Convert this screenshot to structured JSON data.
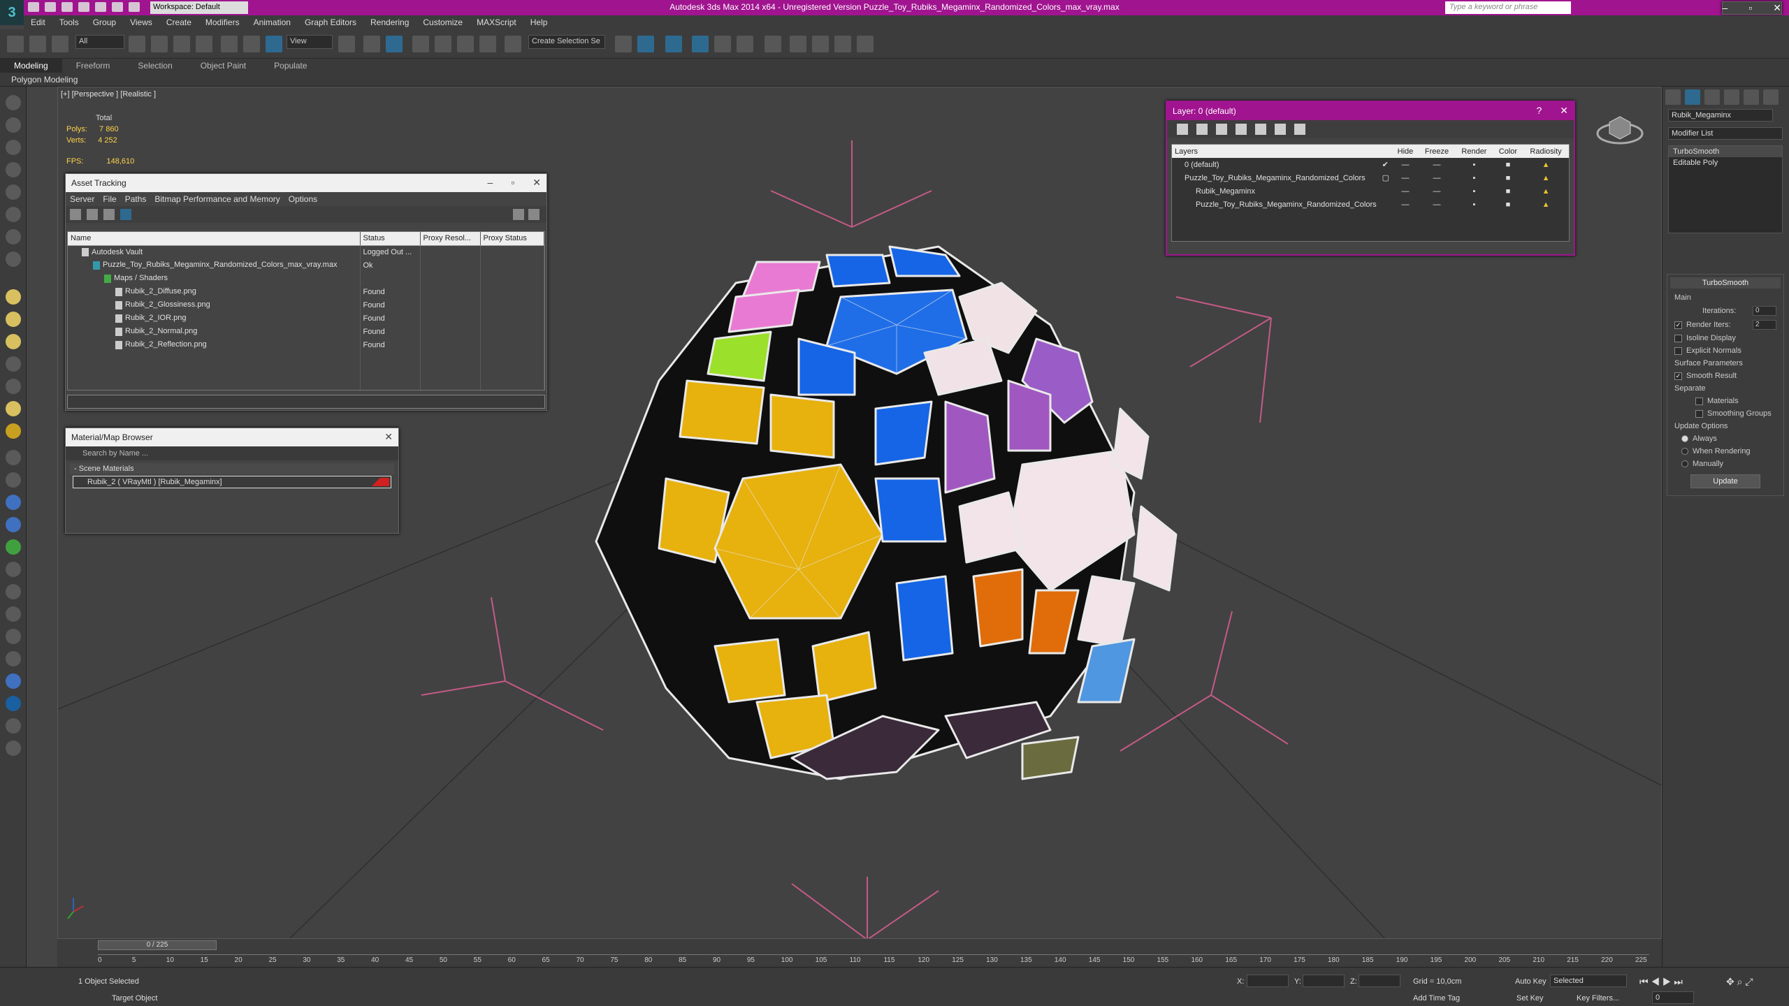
{
  "window": {
    "title": "Autodesk 3ds Max  2014 x64  -  Unregistered Version   Puzzle_Toy_Rubiks_Megaminx_Randomized_Colors_max_vray.max",
    "workspace": "Workspace: Default",
    "search_placeholder": "Type a keyword or phrase",
    "logo": "3"
  },
  "menu": [
    "Edit",
    "Tools",
    "Group",
    "Views",
    "Create",
    "Modifiers",
    "Animation",
    "Graph Editors",
    "Rendering",
    "Customize",
    "MAXScript",
    "Help"
  ],
  "toolbar": {
    "filter": "All",
    "refcoord": "View",
    "selection_set": "Create Selection Se"
  },
  "ribbon": {
    "tabs": [
      "Modeling",
      "Freeform",
      "Selection",
      "Object Paint",
      "Populate"
    ],
    "subtab": "Polygon Modeling"
  },
  "viewport": {
    "label": "[+] [Perspective ] [Realistic ]",
    "stats_header": "Total",
    "polys_label": "Polys:",
    "polys": "7 860",
    "verts_label": "Verts:",
    "verts": "4 252",
    "fps_label": "FPS:",
    "fps": "148,610"
  },
  "asset_tracking": {
    "title": "Asset Tracking",
    "menu": [
      "Server",
      "File",
      "Paths",
      "Bitmap Performance and Memory",
      "Options"
    ],
    "columns": [
      "Name",
      "Status",
      "Proxy Resol...",
      "Proxy Status"
    ],
    "rows": [
      {
        "name": "Autodesk Vault",
        "status": "Logged Out ..."
      },
      {
        "name": "Puzzle_Toy_Rubiks_Megaminx_Randomized_Colors_max_vray.max",
        "status": "Ok"
      },
      {
        "name": "Maps / Shaders",
        "status": ""
      },
      {
        "name": "Rubik_2_Diffuse.png",
        "status": "Found"
      },
      {
        "name": "Rubik_2_Glossiness.png",
        "status": "Found"
      },
      {
        "name": "Rubik_2_IOR.png",
        "status": "Found"
      },
      {
        "name": "Rubik_2_Normal.png",
        "status": "Found"
      },
      {
        "name": "Rubik_2_Reflection.png",
        "status": "Found"
      }
    ]
  },
  "material_browser": {
    "title": "Material/Map Browser",
    "search_placeholder": "Search by Name ...",
    "section": "- Scene Materials",
    "item": "Rubik_2  ( VRayMtl )  [Rubik_Megaminx]"
  },
  "layer_window": {
    "title": "Layer: 0 (default)",
    "columns": [
      "Layers",
      "Hide",
      "Freeze",
      "Render",
      "Color",
      "Radiosity"
    ],
    "rows": [
      {
        "name": "0 (default)"
      },
      {
        "name": "Puzzle_Toy_Rubiks_Megaminx_Randomized_Colors"
      },
      {
        "name": "Rubik_Megaminx"
      },
      {
        "name": "Puzzle_Toy_Rubiks_Megaminx_Randomized_Colors"
      }
    ]
  },
  "command_panel": {
    "object_name": "Rubik_Megaminx",
    "modifier_list": "Modifier List",
    "stack": [
      "TurboSmooth",
      "Editable Poly"
    ],
    "turbosmooth": {
      "title": "TurboSmooth",
      "main": "Main",
      "iterations_label": "Iterations:",
      "iterations": "0",
      "render_iters_label": "Render Iters:",
      "render_iters": "2",
      "isoline": "Isoline Display",
      "explicit": "Explicit Normals",
      "surface_params": "Surface Parameters",
      "smooth_result": "Smooth Result",
      "separate": "Separate",
      "materials": "Materials",
      "smoothing_groups": "Smoothing Groups",
      "update_options": "Update Options",
      "always": "Always",
      "when_rendering": "When Rendering",
      "manually": "Manually",
      "update_button": "Update"
    }
  },
  "timeline": {
    "slider": "0 / 225",
    "ticks": [
      "0",
      "5",
      "10",
      "15",
      "20",
      "25",
      "30",
      "35",
      "40",
      "45",
      "50",
      "55",
      "60",
      "65",
      "70",
      "75",
      "80",
      "85",
      "90",
      "95",
      "100",
      "105",
      "110",
      "115",
      "120",
      "125",
      "130",
      "135",
      "140",
      "145",
      "150",
      "155",
      "160",
      "165",
      "170",
      "175",
      "180",
      "185",
      "190",
      "195",
      "200",
      "205",
      "210",
      "215",
      "220",
      "225"
    ]
  },
  "status": {
    "selected": "1 Object Selected",
    "prompt": "Target Object",
    "x_label": "X:",
    "y_label": "Y:",
    "z_label": "Z:",
    "grid": "Grid = 10,0cm",
    "add_time_tag": "Add Time Tag",
    "auto_key": "Auto Key",
    "set_key": "Set Key",
    "selected_dropdown": "Selected",
    "key_filters": "Key Filters...",
    "frame": "0"
  }
}
